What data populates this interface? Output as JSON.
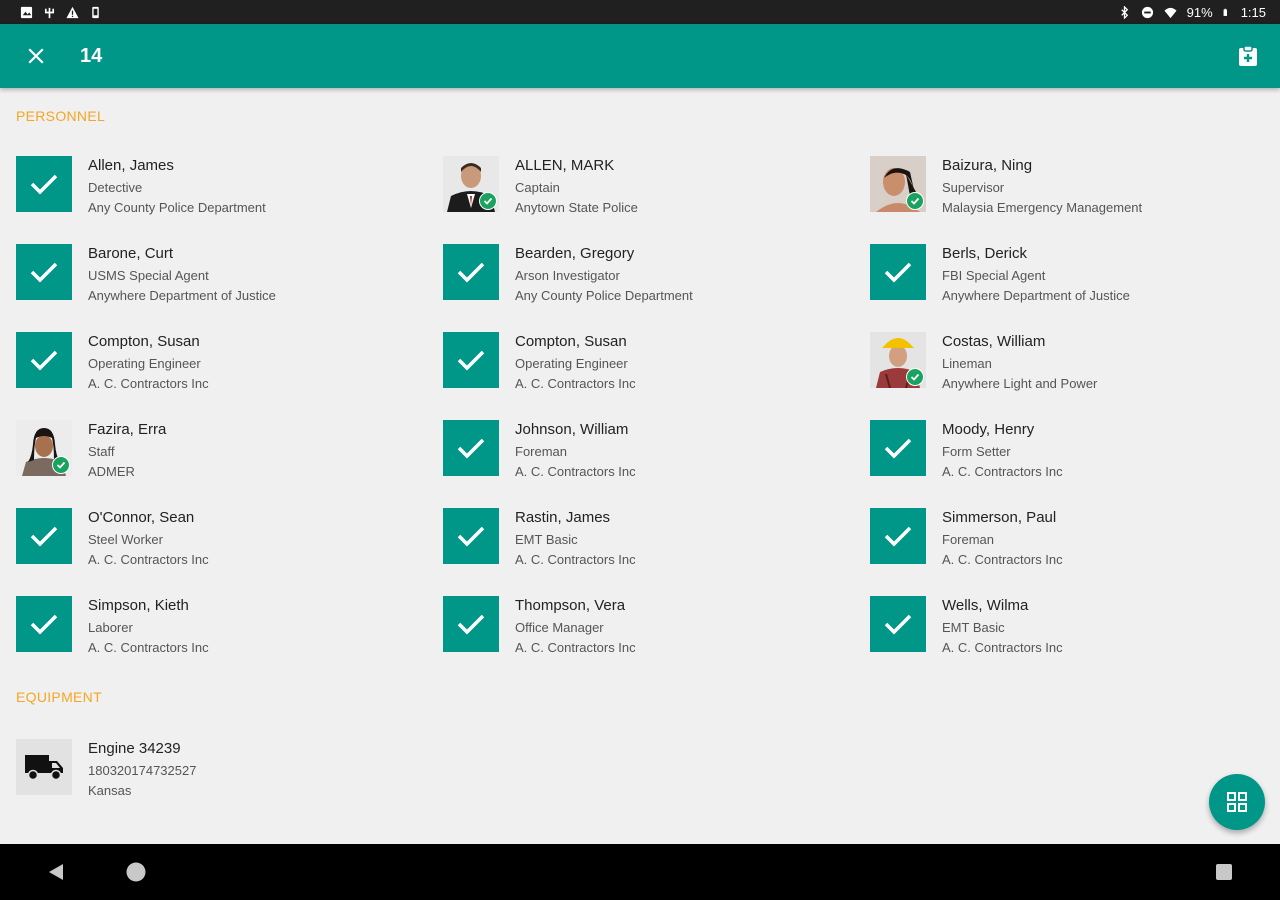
{
  "status_bar": {
    "battery": "91%",
    "time": "1:15"
  },
  "app_bar": {
    "count": "14",
    "close_icon": "close-icon",
    "action_icon": "clipboard-add-icon"
  },
  "colors": {
    "primary": "#009688",
    "section_header": "#f5a623",
    "badge": "#1aa360"
  },
  "sections": {
    "personnel_label": "PERSONNEL",
    "equipment_label": "EQUIPMENT"
  },
  "personnel": [
    {
      "name": "Allen, James",
      "title": "Detective",
      "org": "Any County Police Department",
      "photo": false
    },
    {
      "name": "ALLEN, MARK",
      "title": "Captain",
      "org": "Anytown State Police",
      "photo": true
    },
    {
      "name": "Baizura, Ning",
      "title": "Supervisor",
      "org": "Malaysia Emergency Management",
      "photo": true
    },
    {
      "name": "Barone, Curt",
      "title": "USMS Special Agent",
      "org": "Anywhere Department of Justice",
      "photo": false
    },
    {
      "name": "Bearden, Gregory",
      "title": "Arson Investigator",
      "org": "Any County Police Department",
      "photo": false
    },
    {
      "name": "Berls, Derick",
      "title": "FBI Special Agent",
      "org": "Anywhere Department of Justice",
      "photo": false
    },
    {
      "name": "Compton, Susan",
      "title": "Operating Engineer",
      "org": "A. C. Contractors Inc",
      "photo": false
    },
    {
      "name": "Compton, Susan",
      "title": "Operating Engineer",
      "org": "A. C. Contractors Inc",
      "photo": false
    },
    {
      "name": "Costas, William",
      "title": "Lineman",
      "org": "Anywhere Light and Power",
      "photo": true
    },
    {
      "name": "Fazira, Erra",
      "title": "Staff",
      "org": "ADMER",
      "photo": true
    },
    {
      "name": "Johnson, William",
      "title": "Foreman",
      "org": "A. C. Contractors Inc",
      "photo": false
    },
    {
      "name": "Moody, Henry",
      "title": "Form Setter",
      "org": "A. C. Contractors Inc",
      "photo": false
    },
    {
      "name": "O'Connor, Sean",
      "title": "Steel Worker",
      "org": "A. C. Contractors Inc",
      "photo": false
    },
    {
      "name": "Rastin, James",
      "title": "EMT Basic",
      "org": "A. C. Contractors Inc",
      "photo": false
    },
    {
      "name": "Simmerson, Paul",
      "title": "Foreman",
      "org": "A. C. Contractors Inc",
      "photo": false
    },
    {
      "name": "Simpson, Kieth",
      "title": "Laborer",
      "org": "A. C. Contractors Inc",
      "photo": false
    },
    {
      "name": "Thompson, Vera",
      "title": "Office Manager",
      "org": "A. C. Contractors Inc",
      "photo": false
    },
    {
      "name": "Wells, Wilma",
      "title": "EMT Basic",
      "org": "A. C. Contractors Inc",
      "photo": false
    }
  ],
  "equipment": [
    {
      "name": "Engine 34239",
      "id": "180320174732527",
      "location": "Kansas",
      "icon": "truck-icon"
    }
  ],
  "fab": {
    "icon": "qr-scan-icon"
  }
}
